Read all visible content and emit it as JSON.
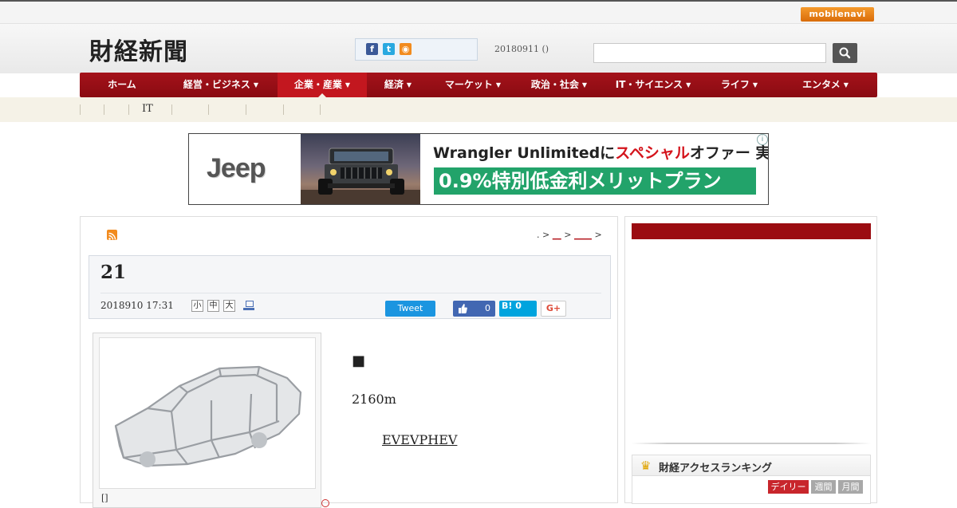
{
  "topbar": {
    "mobile_label": "mobilenavi"
  },
  "header": {
    "logo": "財経新聞",
    "date": "20180911 ()",
    "social": {
      "facebook_icon": "f",
      "twitter_icon": "t",
      "rss_icon": "◉"
    }
  },
  "nav": {
    "items": [
      {
        "label": "ホーム",
        "caret": false
      },
      {
        "label": "経営・ビジネス",
        "caret": true
      },
      {
        "label": "企業・産業",
        "caret": true,
        "active": true
      },
      {
        "label": "経済",
        "caret": true
      },
      {
        "label": "マーケット",
        "caret": true
      },
      {
        "label": "政治・社会",
        "caret": true
      },
      {
        "label": "IT・サイエンス",
        "caret": true
      },
      {
        "label": "ライフ",
        "caret": true
      },
      {
        "label": "エンタメ",
        "caret": true
      }
    ],
    "caret_glyph": "▼"
  },
  "subnav": {
    "label": "IT"
  },
  "ad": {
    "brand": "Jeep",
    "headline_a": "Wrangler Unlimitedに",
    "headline_red1": "スペシャル",
    "headline_b": "オファー",
    "headline_c": " 実施中",
    "offer": "0.9%特別低金利メリットプラン",
    "info_icon": "i"
  },
  "article": {
    "breadcrumb_prefix": ". >",
    "breadcrumb_link1": "__",
    "breadcrumb_sep": ">",
    "breadcrumb_link2": "____",
    "breadcrumb_end": ">",
    "title": "21",
    "posted": "2018910 17:31",
    "font_small": "小",
    "font_medium": "中",
    "font_large": "大",
    "tweet_label": "Tweet",
    "like_count": "0",
    "hatena_label": "B! 0",
    "gplus_label": "G+",
    "figure_caption": "[]",
    "para_marker": "■",
    "para1": "2160m",
    "para2_link": "EVEVPHEV"
  },
  "sidebar": {
    "ranking_title": "財経アクセスランキング",
    "tabs": [
      {
        "label": "デイリー",
        "active": true
      },
      {
        "label": "週間",
        "active": false
      },
      {
        "label": "月間",
        "active": false
      }
    ]
  },
  "colors": {
    "nav_red": "#9b0c11",
    "nav_active": "#c3171f",
    "ad_green": "#22a36a",
    "tweet_blue": "#1b95e0",
    "facebook_blue": "#4267b2",
    "hatena_blue": "#00a4de"
  }
}
